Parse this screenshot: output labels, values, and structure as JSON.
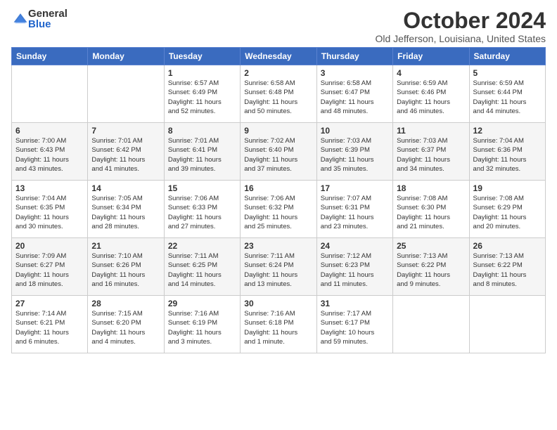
{
  "logo": {
    "general": "General",
    "blue": "Blue"
  },
  "title": "October 2024",
  "location": "Old Jefferson, Louisiana, United States",
  "days_of_week": [
    "Sunday",
    "Monday",
    "Tuesday",
    "Wednesday",
    "Thursday",
    "Friday",
    "Saturday"
  ],
  "weeks": [
    [
      {
        "day": "",
        "detail": ""
      },
      {
        "day": "",
        "detail": ""
      },
      {
        "day": "1",
        "detail": "Sunrise: 6:57 AM\nSunset: 6:49 PM\nDaylight: 11 hours\nand 52 minutes."
      },
      {
        "day": "2",
        "detail": "Sunrise: 6:58 AM\nSunset: 6:48 PM\nDaylight: 11 hours\nand 50 minutes."
      },
      {
        "day": "3",
        "detail": "Sunrise: 6:58 AM\nSunset: 6:47 PM\nDaylight: 11 hours\nand 48 minutes."
      },
      {
        "day": "4",
        "detail": "Sunrise: 6:59 AM\nSunset: 6:46 PM\nDaylight: 11 hours\nand 46 minutes."
      },
      {
        "day": "5",
        "detail": "Sunrise: 6:59 AM\nSunset: 6:44 PM\nDaylight: 11 hours\nand 44 minutes."
      }
    ],
    [
      {
        "day": "6",
        "detail": "Sunrise: 7:00 AM\nSunset: 6:43 PM\nDaylight: 11 hours\nand 43 minutes."
      },
      {
        "day": "7",
        "detail": "Sunrise: 7:01 AM\nSunset: 6:42 PM\nDaylight: 11 hours\nand 41 minutes."
      },
      {
        "day": "8",
        "detail": "Sunrise: 7:01 AM\nSunset: 6:41 PM\nDaylight: 11 hours\nand 39 minutes."
      },
      {
        "day": "9",
        "detail": "Sunrise: 7:02 AM\nSunset: 6:40 PM\nDaylight: 11 hours\nand 37 minutes."
      },
      {
        "day": "10",
        "detail": "Sunrise: 7:03 AM\nSunset: 6:39 PM\nDaylight: 11 hours\nand 35 minutes."
      },
      {
        "day": "11",
        "detail": "Sunrise: 7:03 AM\nSunset: 6:37 PM\nDaylight: 11 hours\nand 34 minutes."
      },
      {
        "day": "12",
        "detail": "Sunrise: 7:04 AM\nSunset: 6:36 PM\nDaylight: 11 hours\nand 32 minutes."
      }
    ],
    [
      {
        "day": "13",
        "detail": "Sunrise: 7:04 AM\nSunset: 6:35 PM\nDaylight: 11 hours\nand 30 minutes."
      },
      {
        "day": "14",
        "detail": "Sunrise: 7:05 AM\nSunset: 6:34 PM\nDaylight: 11 hours\nand 28 minutes."
      },
      {
        "day": "15",
        "detail": "Sunrise: 7:06 AM\nSunset: 6:33 PM\nDaylight: 11 hours\nand 27 minutes."
      },
      {
        "day": "16",
        "detail": "Sunrise: 7:06 AM\nSunset: 6:32 PM\nDaylight: 11 hours\nand 25 minutes."
      },
      {
        "day": "17",
        "detail": "Sunrise: 7:07 AM\nSunset: 6:31 PM\nDaylight: 11 hours\nand 23 minutes."
      },
      {
        "day": "18",
        "detail": "Sunrise: 7:08 AM\nSunset: 6:30 PM\nDaylight: 11 hours\nand 21 minutes."
      },
      {
        "day": "19",
        "detail": "Sunrise: 7:08 AM\nSunset: 6:29 PM\nDaylight: 11 hours\nand 20 minutes."
      }
    ],
    [
      {
        "day": "20",
        "detail": "Sunrise: 7:09 AM\nSunset: 6:27 PM\nDaylight: 11 hours\nand 18 minutes."
      },
      {
        "day": "21",
        "detail": "Sunrise: 7:10 AM\nSunset: 6:26 PM\nDaylight: 11 hours\nand 16 minutes."
      },
      {
        "day": "22",
        "detail": "Sunrise: 7:11 AM\nSunset: 6:25 PM\nDaylight: 11 hours\nand 14 minutes."
      },
      {
        "day": "23",
        "detail": "Sunrise: 7:11 AM\nSunset: 6:24 PM\nDaylight: 11 hours\nand 13 minutes."
      },
      {
        "day": "24",
        "detail": "Sunrise: 7:12 AM\nSunset: 6:23 PM\nDaylight: 11 hours\nand 11 minutes."
      },
      {
        "day": "25",
        "detail": "Sunrise: 7:13 AM\nSunset: 6:22 PM\nDaylight: 11 hours\nand 9 minutes."
      },
      {
        "day": "26",
        "detail": "Sunrise: 7:13 AM\nSunset: 6:22 PM\nDaylight: 11 hours\nand 8 minutes."
      }
    ],
    [
      {
        "day": "27",
        "detail": "Sunrise: 7:14 AM\nSunset: 6:21 PM\nDaylight: 11 hours\nand 6 minutes."
      },
      {
        "day": "28",
        "detail": "Sunrise: 7:15 AM\nSunset: 6:20 PM\nDaylight: 11 hours\nand 4 minutes."
      },
      {
        "day": "29",
        "detail": "Sunrise: 7:16 AM\nSunset: 6:19 PM\nDaylight: 11 hours\nand 3 minutes."
      },
      {
        "day": "30",
        "detail": "Sunrise: 7:16 AM\nSunset: 6:18 PM\nDaylight: 11 hours\nand 1 minute."
      },
      {
        "day": "31",
        "detail": "Sunrise: 7:17 AM\nSunset: 6:17 PM\nDaylight: 10 hours\nand 59 minutes."
      },
      {
        "day": "",
        "detail": ""
      },
      {
        "day": "",
        "detail": ""
      }
    ]
  ]
}
